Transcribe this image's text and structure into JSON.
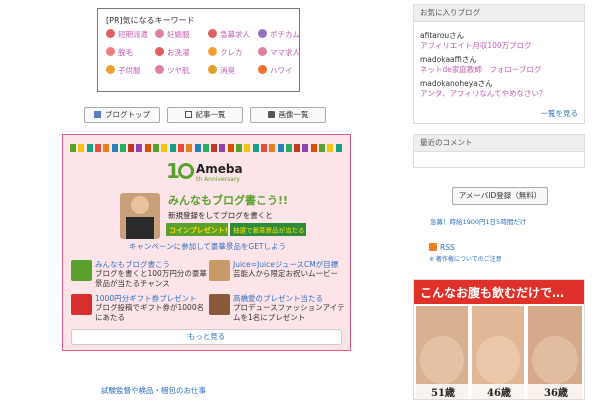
{
  "keywords": {
    "title": "[PR]気になるキーワード",
    "items": [
      {
        "label": "短期派遣",
        "color": "#e06060"
      },
      {
        "label": "妊娠服",
        "color": "#e080a0"
      },
      {
        "label": "急募求人",
        "color": "#e06060"
      },
      {
        "label": "ポチカム",
        "color": "#9070c0"
      },
      {
        "label": "脱毛",
        "color": "#f08080"
      },
      {
        "label": "お洗濯",
        "color": "#e06060"
      },
      {
        "label": "クレカ",
        "color": "#f0a030"
      },
      {
        "label": "ママ求人",
        "color": "#e080a0"
      },
      {
        "label": "子供服",
        "color": "#f0a030"
      },
      {
        "label": "ツヤ肌",
        "color": "#e080a0"
      },
      {
        "label": "消臭",
        "color": "#e0a030"
      },
      {
        "label": "ハワイ",
        "color": "#f07030"
      }
    ]
  },
  "nav": {
    "blog_top": "ブログトップ",
    "articles": "記事一覧",
    "images": "画像一覧"
  },
  "ameba": {
    "logo_text": "Ameba",
    "logo_sub": "th Anniversary",
    "banner_title": "みんなもブログ書こう!!",
    "banner_sub": "新規登録をしてブログを書くと",
    "banner_tag1": "コインプレゼント!",
    "banner_tag2": "抽選で豪華景品が当たる",
    "campaign": "キャンペーンに参加して豪華景品をGETしよう",
    "promos": [
      {
        "title": "みんなもブログ書こう",
        "desc": "ブログを書くと100万円分の豪華景品が当たるチャンス"
      },
      {
        "title": "Juice=JuiceジュースCMが目標",
        "desc": "芸能人から限定お祝いムービー"
      },
      {
        "title": "1000円分ギフト券プレゼント",
        "desc": "ブログ投稿でギフト券が1000名にあたる"
      },
      {
        "title": "高橋愛のプレゼント当たる",
        "desc": "プロデュースファッションアイテムを1名にプレゼント"
      }
    ],
    "more": "もっと見る"
  },
  "footer_link": "試験監督や検品・梱包のお仕事",
  "favorites": {
    "header": "お気に入りブログ",
    "items": [
      {
        "name": "afitarouさん",
        "blog": "アフィリエイト月収100万ブログ"
      },
      {
        "name": "madokaaffiさん",
        "blog": "ネットde家庭教師　フォローブログ"
      },
      {
        "name": "madokanoheyaさん",
        "blog": "アンタ、アフィリなんてやめなさい？"
      }
    ],
    "see_all": "一覧を見る"
  },
  "comments": {
    "header": "最近のコメント"
  },
  "register_button": "アメーバID登録（無料）",
  "promo_text": "急募！時給1900円1日5時間だけ",
  "rss": {
    "label": "RSS",
    "note": "※ 著作権についてのご注意"
  },
  "ad": {
    "headline": "こんなお腹も飲むだけで…",
    "ages": [
      "51歳",
      "46歳",
      "36歳"
    ]
  }
}
